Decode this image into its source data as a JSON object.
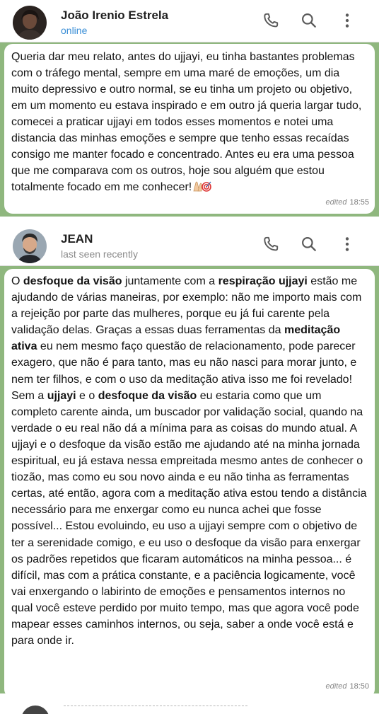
{
  "chats": [
    {
      "contact": {
        "name": "João Irenio Estrela",
        "status": "online"
      },
      "message": {
        "paragraphs": [
          [
            {
              "text": "Queria dar meu relato, antes do ujjayi, eu tinha bastantes problemas com o tráfego mental, sempre em uma maré de emoções, um dia muito depressivo e outro normal, se eu tinha um projeto ou objetivo, em um momento eu estava inspirado e em outro já queria largar tudo, comecei a praticar ujjayi em todos esses momentos e notei uma distancia das minhas emoções e sempre que tenho essas recaídas consigo me manter focado e concentrado. Antes eu era uma pessoa que me comparava com os outros, hoje sou alguém que estou totalmente focado em me conhecer!",
              "bold": false
            }
          ]
        ],
        "emoji": [
          "folded-hands-emoji",
          "target-emoji"
        ],
        "edited_label": "edited",
        "time": "18:55"
      }
    },
    {
      "contact": {
        "name": "JEAN",
        "status": "last seen recently"
      },
      "message": {
        "segments": [
          {
            "text": "O ",
            "bold": false
          },
          {
            "text": "desfoque da visão",
            "bold": true
          },
          {
            "text": " juntamente com a ",
            "bold": false
          },
          {
            "text": "respiração ujjayi",
            "bold": true
          },
          {
            "text": " estão me ajudando de várias maneiras, por exemplo: não me importo mais com a rejeição por parte das mulheres, porque eu já fui carente pela validação delas. Graças a essas duas ferramentas da ",
            "bold": false
          },
          {
            "text": "meditação ativa",
            "bold": true
          },
          {
            "text": " eu nem mesmo faço questão de relacionamento, pode parecer exagero, que não é para tanto, mas eu não nasci para morar junto, e nem ter filhos, e com o uso da meditação ativa isso me foi revelado! Sem a ",
            "bold": false
          },
          {
            "text": "ujjayi",
            "bold": true
          },
          {
            "text": " e o ",
            "bold": false
          },
          {
            "text": "desfoque da visão",
            "bold": true
          },
          {
            "text": " eu estaria como que um completo carente ainda, um buscador por validação social, quando na verdade o eu real não dá a mínima para as coisas do mundo atual. A ujjayi e o desfoque da visão estão me ajudando até na minha jornada espiritual, eu já estava nessa empreitada mesmo antes de conhecer o tiozão, mas como eu sou novo ainda e eu não tinha as ferramentas certas, até então, agora com a meditação ativa estou tendo a distância necessário para me enxergar como eu nunca achei que fosse possível... Estou evoluindo, eu uso a ujjayi sempre com o objetivo de ter a serenidade comigo, e eu uso o desfoque da visão para enxergar os padrões repetidos que ficaram automáticos na minha pessoa... é difícil, mas com a prática constante, e a paciência logicamente, você  vai enxergando o labirinto de emoções e pensamentos internos no qual você esteve perdido por muito tempo, mas que agora você pode mapear esses caminhos internos, ou seja, saber a onde você está e para onde ir.",
            "bold": false
          }
        ],
        "edited_label": "edited",
        "time": "18:50"
      }
    }
  ],
  "header_icons": [
    "phone-icon",
    "search-icon",
    "more-vertical-icon"
  ],
  "colors": {
    "chat_background": "#8fb77e",
    "bubble": "#ffffff",
    "online_status": "#3a8ed6",
    "muted_text": "#8a8a8a"
  }
}
